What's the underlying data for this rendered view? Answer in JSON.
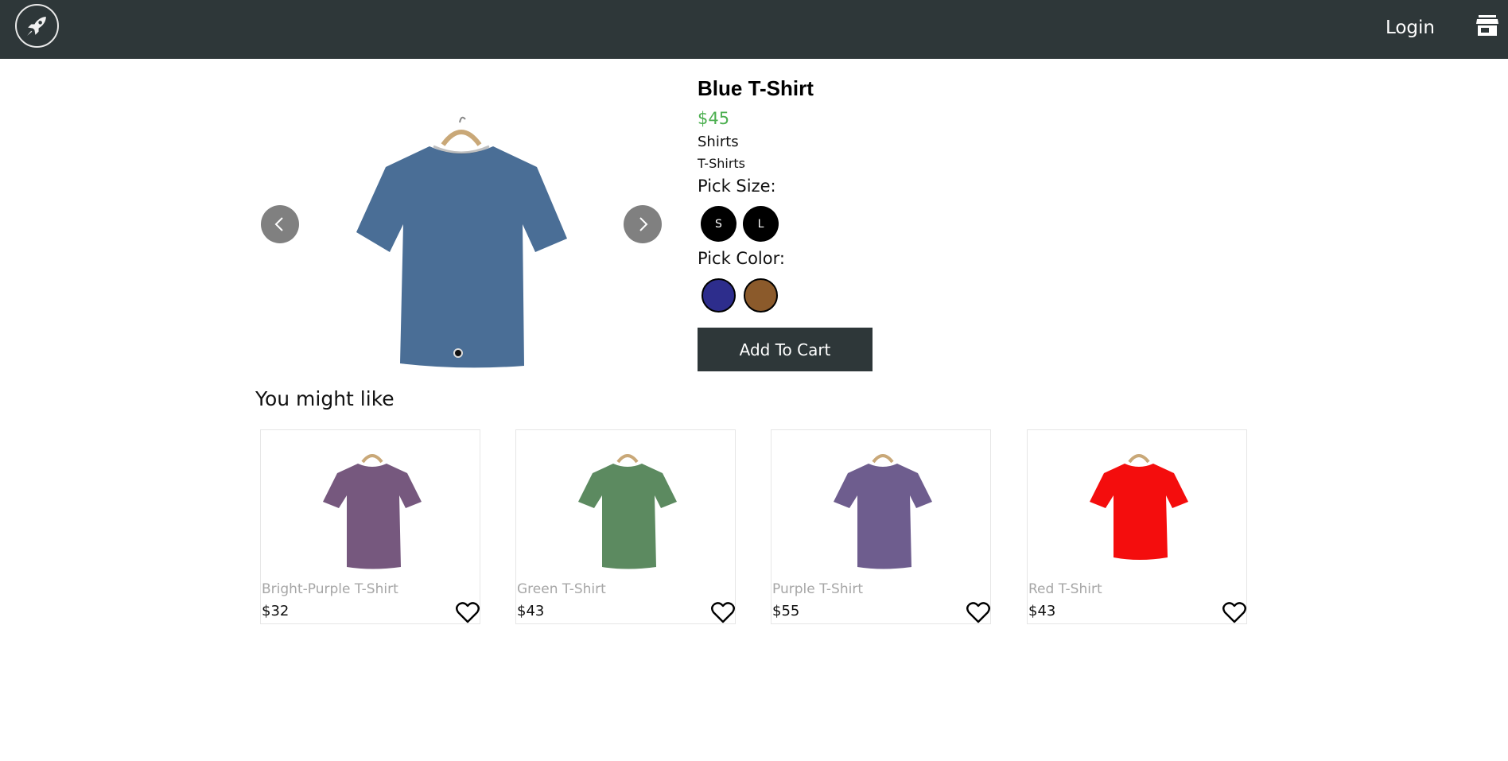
{
  "header": {
    "logo_icon": "rocket-icon",
    "login_label": "Login",
    "store_icon": "store-icon",
    "bg_color": "#2e3739"
  },
  "product": {
    "title": "Blue T-Shirt",
    "price": "$45",
    "category": "Shirts",
    "subcategory": "T-Shirts",
    "image_color": "#4a6e96",
    "pick_size_label": "Pick Size:",
    "sizes": [
      "S",
      "L"
    ],
    "pick_color_label": "Pick Color:",
    "colors": [
      "#2d2d8c",
      "#8b5a2b"
    ],
    "add_to_cart_label": "Add To Cart",
    "price_color": "#4caf50"
  },
  "recommendations": {
    "title": "You might like",
    "items": [
      {
        "name": "Bright-Purple T-Shirt",
        "price": "$32",
        "color": "#76587e"
      },
      {
        "name": "Green T-Shirt",
        "price": "$43",
        "color": "#5c8a60"
      },
      {
        "name": "Purple T-Shirt",
        "price": "$55",
        "color": "#6e5d8e"
      },
      {
        "name": "Red T-Shirt",
        "price": "$43",
        "color": "#f40d0d"
      }
    ]
  }
}
